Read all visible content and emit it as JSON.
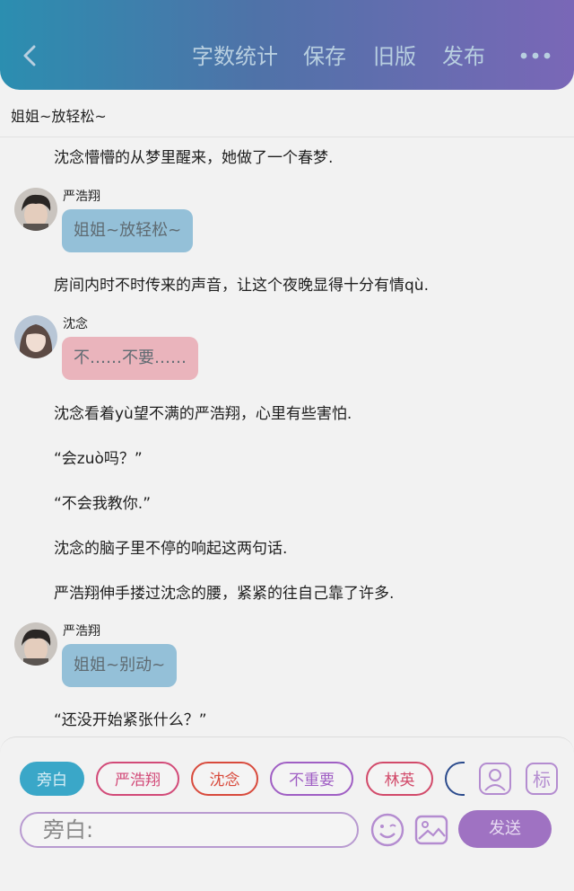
{
  "header": {
    "buttons": [
      "字数统计",
      "保存",
      "旧版",
      "发布"
    ]
  },
  "chapter": {
    "title": "姐姐~放轻松~"
  },
  "story": {
    "narr1": "沈念懵懵的从梦里醒来，她做了一个春梦.",
    "msg1": {
      "name": "严浩翔",
      "text": "姐姐~放轻松~"
    },
    "narr2": "房间内时不时传来的声音，让这个夜晚显得十分有情qù.",
    "msg2": {
      "name": "沈念",
      "text": "不……不要……"
    },
    "narr3": "沈念看着yù望不满的严浩翔，心里有些害怕.",
    "narr4": "“会zuò吗？”",
    "narr5": "“不会我教你.”",
    "narr6": "沈念的脑子里不停的响起这两句话.",
    "narr7": "严浩翔伸手搂过沈念的腰，紧紧的往自己靠了许多.",
    "msg3": {
      "name": "严浩翔",
      "text": "姐姐~别动~"
    },
    "narr8": "“还没开始紧张什么？”"
  },
  "characters": [
    {
      "label": "旁白",
      "color": "#3aa7c8"
    },
    {
      "label": "严浩翔",
      "color": "#d24a78"
    },
    {
      "label": "沈念",
      "color": "#d84a3c"
    },
    {
      "label": "不重要",
      "color": "#a05fc4"
    },
    {
      "label": "林英",
      "color": "#d24a6a"
    }
  ],
  "composer": {
    "input_value": "旁白:",
    "send_label": "发送",
    "tag_icon_text": "标"
  },
  "icons": [
    "back-icon",
    "more-icon",
    "avatar-icon",
    "tag-icon",
    "emoji-icon",
    "image-icon"
  ]
}
